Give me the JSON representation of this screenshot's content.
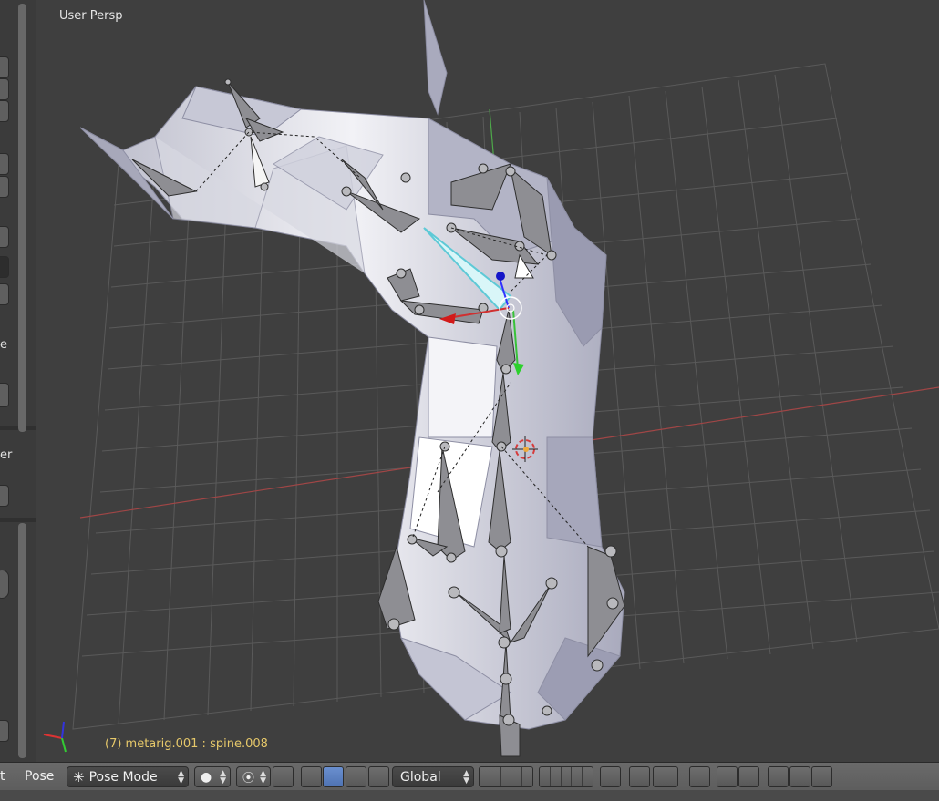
{
  "viewport": {
    "title": "User Persp",
    "status": "(7) metarig.001 : spine.008"
  },
  "shelf": {
    "partial_labels": [
      "e",
      "er"
    ]
  },
  "header": {
    "left_clip": "t",
    "menu_pose": "Pose",
    "mode_label": "Pose Mode",
    "orientation_label": "Global"
  },
  "icons": [
    "pose-mode-icon",
    "viewport-shading-icon",
    "pivot-point-icon",
    "manipulator-icon",
    "translate-manipulator-icon",
    "rotate-manipulator-icon",
    "scale-manipulator-icon",
    "layer-buttons",
    "armature-layer-buttons",
    "lock-icon",
    "proportional-edit-icon",
    "snap-icon",
    "snap-element-icon",
    "render-icon",
    "clapper-icon",
    "copy-pose-icon",
    "paste-pose-icon",
    "paste-flipped-pose-icon"
  ],
  "colors": {
    "viewport_bg": "#3f3f3f",
    "grid": "#5a5a5a",
    "mesh": "#c9cad8",
    "bone": "#8a8a8e",
    "selected_bone": "#5ec9d6",
    "axis_x": "#c04a4a",
    "axis_y": "#57b14b",
    "status_text": "#e6c86a",
    "active_tool": "#5b7fc1"
  }
}
